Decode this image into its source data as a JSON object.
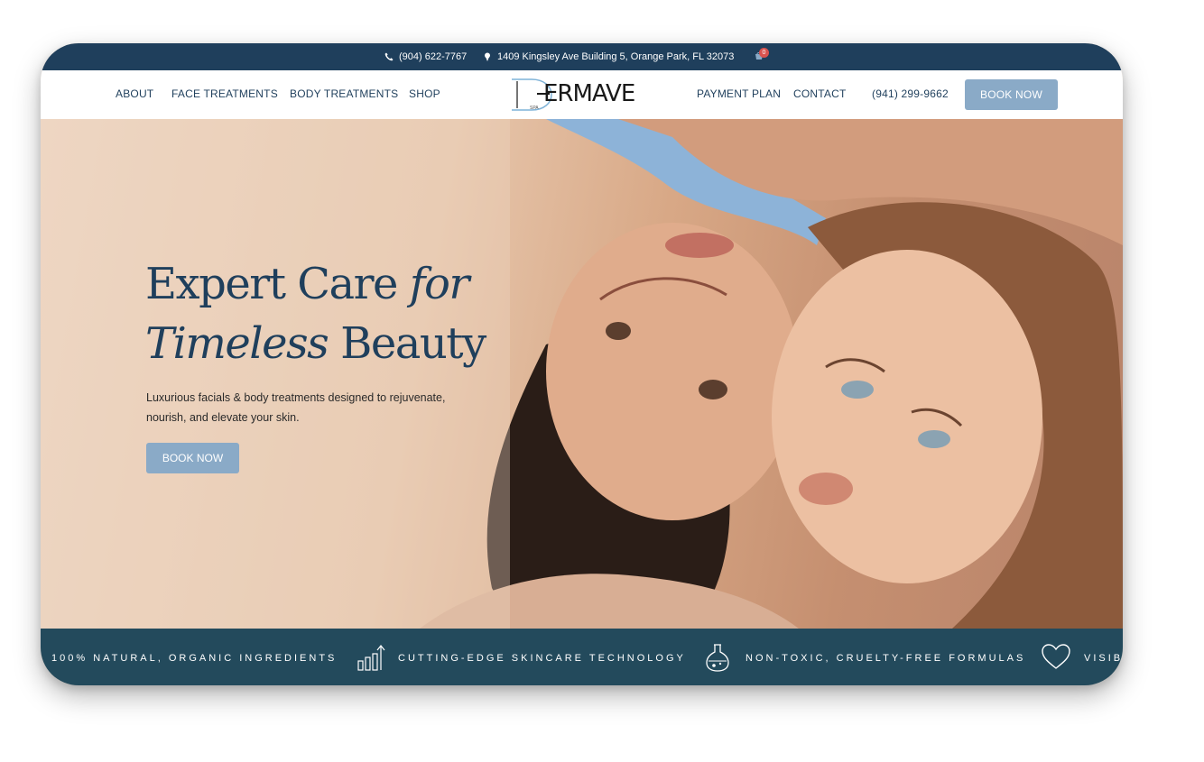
{
  "topbar": {
    "phone": "(904) 622-7767",
    "address": "1409 Kingsley Ave Building 5, Orange Park, FL 32073",
    "cart_count": "0"
  },
  "nav": {
    "left": [
      "ABOUT",
      "FACE TREATMENTS",
      "BODY TREATMENTS",
      "SHOP"
    ],
    "right": [
      "PAYMENT PLAN",
      "CONTACT"
    ],
    "phone": "(941) 299-9662",
    "book_label": "BOOK NOW",
    "logo_text": "ERMAVE",
    "logo_sub": "SPA"
  },
  "hero": {
    "headline_part1": "Expert Care ",
    "headline_em1": "for",
    "headline_em2": "Timeless",
    "headline_part2": " Beauty",
    "subtext": "Luxurious facials & body treatments designed to rejuvenate, nourish, and elevate your skin.",
    "book_label": "BOOK NOW"
  },
  "features": [
    {
      "label": "100% NATURAL, ORGANIC INGREDIENTS",
      "icon": "growth-chart-icon"
    },
    {
      "label": "CUTTING-EDGE SKINCARE TECHNOLOGY",
      "icon": "flask-icon"
    },
    {
      "label": "NON-TOXIC, CRUELTY-FREE FORMULAS",
      "icon": "heart-icon"
    },
    {
      "label": "VISIB",
      "icon": ""
    }
  ],
  "colors": {
    "navy": "#1f3f5c",
    "teal": "#234a5c",
    "button": "#8aaac7"
  }
}
